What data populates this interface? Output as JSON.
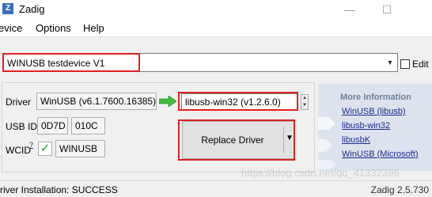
{
  "window": {
    "title": "Zadig",
    "icon_letter": "Z",
    "minimize_glyph": "—",
    "maximize_glyph": "☐"
  },
  "menu": {
    "items": [
      "evice",
      "Options",
      "Help"
    ]
  },
  "device_combo": {
    "value": "WINUSB testdevice V1",
    "arrow_glyph": "▼"
  },
  "edit": {
    "label": "Edit",
    "checked": false
  },
  "driver": {
    "label": "Driver",
    "current": "WinUSB (v6.1.7600.16385)",
    "target": "libusb-win32 (v1.2.6.0)"
  },
  "usb_id": {
    "label": "USB ID",
    "vid": "0D7D",
    "pid": "010C"
  },
  "wcid": {
    "label": "WCID",
    "superscript": "?",
    "check_glyph": "✓",
    "value": "WINUSB"
  },
  "replace_button": {
    "label": "Replace Driver",
    "dropdown_glyph": "▼"
  },
  "more_info": {
    "title": "More Information",
    "links": [
      "WinUSB (libusb)",
      "libusb-win32",
      "libusbK",
      "WinUSB (Microsoft)"
    ]
  },
  "status": {
    "message": "river Installation: SUCCESS",
    "version": "Zadig 2.5.730"
  },
  "watermark": "https://blog.csdn.net/qq_41332396",
  "colors": {
    "highlight_red": "#e02020",
    "check_green": "#1f9a2a",
    "arrow_green": "#3fbf3f",
    "link_blue": "#1b2a8c",
    "info_panel": "#dce3ee"
  }
}
